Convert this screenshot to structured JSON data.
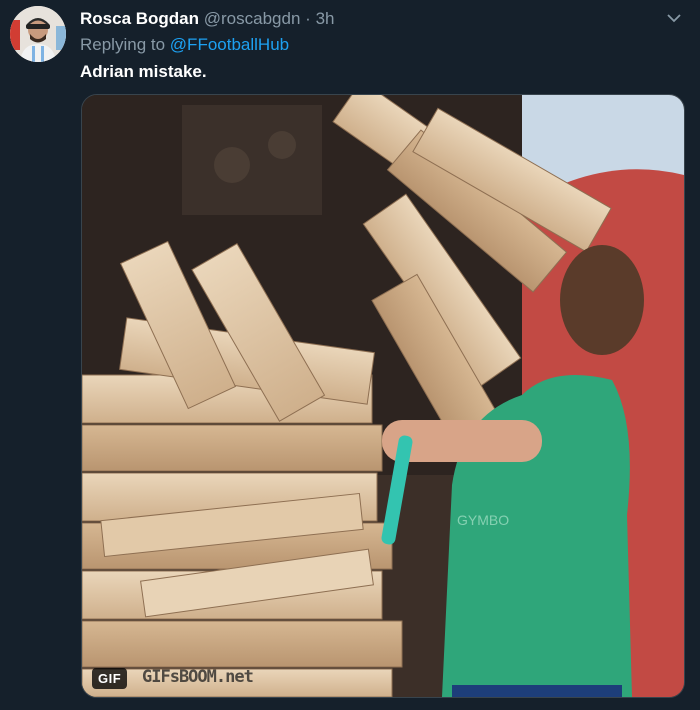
{
  "tweet": {
    "author_name": "Rosca Bogdan",
    "author_handle": "@roscabgdn",
    "separator": "·",
    "time": "3h",
    "reply_prefix": "Replying to",
    "reply_to": "@FFootballHub",
    "text": "Adrian mistake."
  },
  "media": {
    "badge": "GIF",
    "watermark": "GIFsBOOM.net"
  },
  "colors": {
    "background": "#15202b",
    "secondary_text": "#8899a6",
    "link": "#1da1f2",
    "border": "#38444d"
  },
  "icons": {
    "avatar": "user-avatar",
    "caret": "chevron-down-icon"
  }
}
